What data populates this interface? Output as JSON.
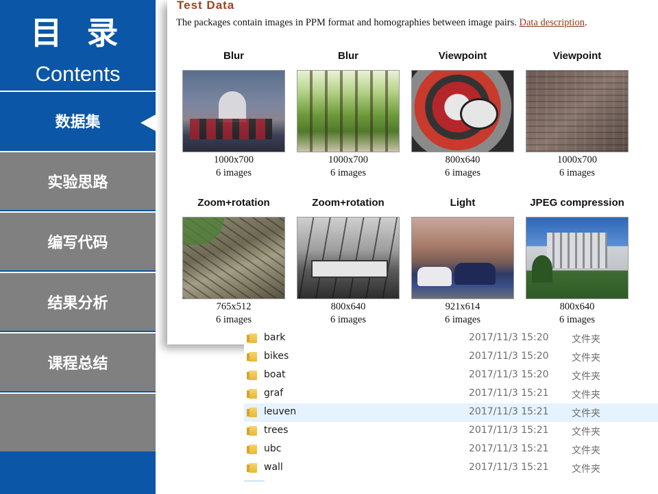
{
  "sidebar": {
    "title": "目 录",
    "subtitle": "Contents",
    "items": [
      {
        "label": "数据集",
        "active": true
      },
      {
        "label": "实验思路",
        "active": false
      },
      {
        "label": "编写代码",
        "active": false
      },
      {
        "label": "结果分析",
        "active": false
      },
      {
        "label": "课程总结",
        "active": false
      },
      {
        "label": "",
        "active": false
      }
    ]
  },
  "panel": {
    "title": "Test Data",
    "desc_text": "The packages contain images in PPM format and homographies between image pairs. ",
    "desc_link": "Data description",
    "desc_end": ".",
    "datasets": [
      {
        "category": "Blur",
        "resolution": "1000x700",
        "count": "6 images",
        "thumb": "t-blur1"
      },
      {
        "category": "Blur",
        "resolution": "1000x700",
        "count": "6 images",
        "thumb": "t-blur2"
      },
      {
        "category": "Viewpoint",
        "resolution": "800x640",
        "count": "6 images",
        "thumb": "t-graf"
      },
      {
        "category": "Viewpoint",
        "resolution": "1000x700",
        "count": "6 images",
        "thumb": "t-wall"
      },
      {
        "category": "Zoom+rotation",
        "resolution": "765x512",
        "count": "6 images",
        "thumb": "t-bark"
      },
      {
        "category": "Zoom+rotation",
        "resolution": "800x640",
        "count": "6 images",
        "thumb": "t-boat"
      },
      {
        "category": "Light",
        "resolution": "921x614",
        "count": "6 images",
        "thumb": "t-leuven"
      },
      {
        "category": "JPEG compression",
        "resolution": "800x640",
        "count": "6 images",
        "thumb": "t-ubc"
      }
    ]
  },
  "files": [
    {
      "name": "bark",
      "date": "2017/11/3 15:20",
      "type": "文件夹",
      "selected": false
    },
    {
      "name": "bikes",
      "date": "2017/11/3 15:20",
      "type": "文件夹",
      "selected": false
    },
    {
      "name": "boat",
      "date": "2017/11/3 15:20",
      "type": "文件夹",
      "selected": false
    },
    {
      "name": "graf",
      "date": "2017/11/3 15:21",
      "type": "文件夹",
      "selected": false
    },
    {
      "name": "leuven",
      "date": "2017/11/3 15:21",
      "type": "文件夹",
      "selected": true
    },
    {
      "name": "trees",
      "date": "2017/11/3 15:21",
      "type": "文件夹",
      "selected": false
    },
    {
      "name": "ubc",
      "date": "2017/11/3 15:21",
      "type": "文件夹",
      "selected": false
    },
    {
      "name": "wall",
      "date": "2017/11/3 15:21",
      "type": "文件夹",
      "selected": false
    }
  ]
}
